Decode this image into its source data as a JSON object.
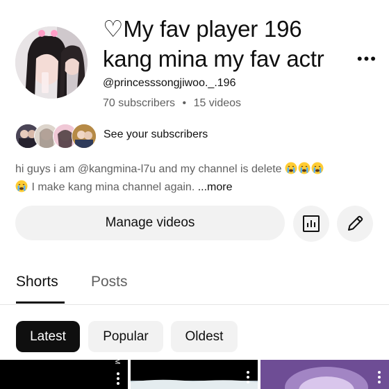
{
  "channel": {
    "title_line1": "♡My fav player 196",
    "title_line2": "kang mina my fav actr",
    "title_ellipsis": "•••",
    "handle": "@princesssongjiwoo._.196",
    "subscribers": "70 subscribers",
    "separator": "•",
    "videos": "15 videos"
  },
  "subscribers_row": {
    "link_label": "See your subscribers"
  },
  "description": {
    "part1": "hi guys i am @kangmina-l7u and my channel is delete",
    "part2": "I make kang mina channel again.",
    "more_label": "...more"
  },
  "actions": {
    "manage_label": "Manage videos",
    "analytics_icon": "analytics-icon",
    "edit_icon": "pencil-icon"
  },
  "tabs": {
    "shorts_label": "Shorts",
    "posts_label": "Posts",
    "active": "Shorts"
  },
  "filters": {
    "latest": "Latest",
    "popular": "Popular",
    "oldest": "Oldest",
    "selected": "Latest"
  },
  "thumbnails": {
    "first_side_text": "M"
  },
  "colors": {
    "text_primary": "#0f0f0f",
    "text_secondary": "#606060",
    "chip_bg": "#f2f2f2",
    "chip_active_bg": "#0f0f0f"
  }
}
